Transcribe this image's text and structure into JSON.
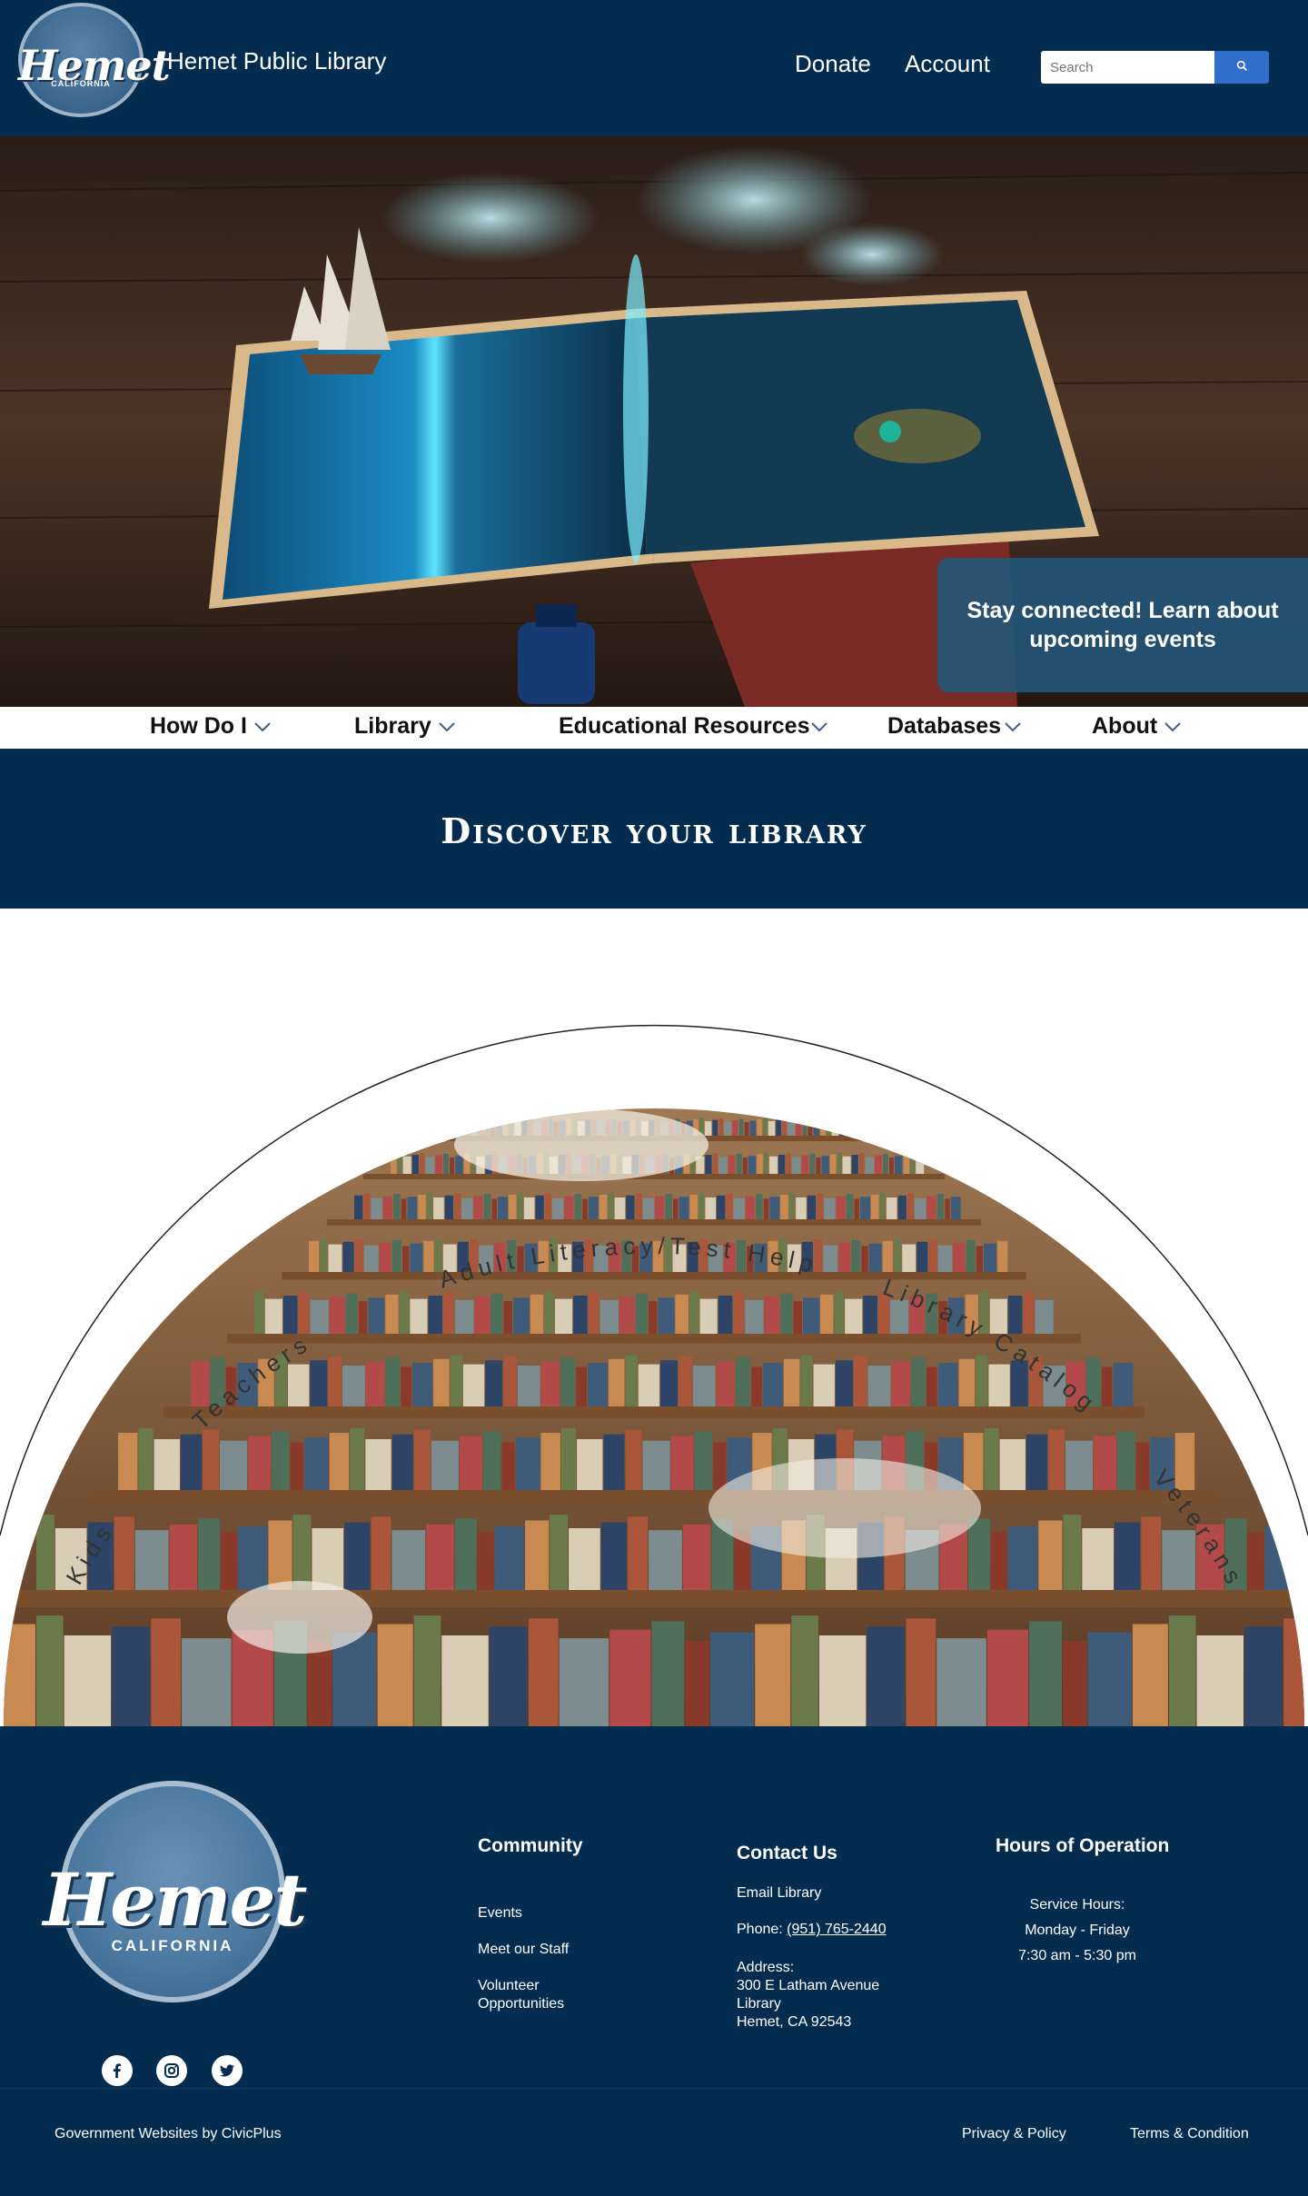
{
  "header": {
    "logo_script": "Hemet",
    "logo_subtitle": "CALIFORNIA",
    "site_title": "Hemet Public Library",
    "nav": {
      "donate": "Donate",
      "account": "Account"
    },
    "search": {
      "placeholder": "Search",
      "value": ""
    }
  },
  "hero": {
    "event_card_text": "Stay connected! Learn about upcoming events"
  },
  "main_nav": {
    "items": [
      {
        "label": "How Do I"
      },
      {
        "label": "Library"
      },
      {
        "label": "Educational Resources"
      },
      {
        "label": "Databases"
      },
      {
        "label": "About"
      }
    ]
  },
  "discover": {
    "title": "Discover your library"
  },
  "arc_links": [
    "Kids",
    "Teachers",
    "Adult Literacy/Test Help",
    "Library Catalog",
    "Veterans"
  ],
  "footer": {
    "logo_script": "Hemet",
    "logo_subtitle": "CALIFORNIA",
    "community": {
      "heading": "Community",
      "links": [
        "Events",
        "Meet our Staff",
        "Volunteer Opportunities"
      ]
    },
    "contact": {
      "heading": "Contact Us",
      "email": "Email Library",
      "phone_label": "Phone:",
      "phone_number": "(951) 765-2440",
      "address_label": "Address:",
      "address_lines": [
        "300 E Latham Avenue",
        "Library",
        "Hemet, CA 92543"
      ]
    },
    "hours": {
      "heading": "Hours of Operation",
      "label": "Service Hours:",
      "days": "Monday - Friday",
      "time": "7:30 am - 5:30 pm"
    },
    "social_icons": [
      "facebook-icon",
      "instagram-icon",
      "twitter-icon"
    ],
    "bottom": {
      "civicplus": "Government Websites by CivicPlus",
      "privacy": "Privacy & Policy",
      "terms": "Terms & Condition"
    }
  },
  "colors": {
    "navy": "#042c4f",
    "search_button": "#2f6fcb",
    "event_card": "#21587b"
  }
}
